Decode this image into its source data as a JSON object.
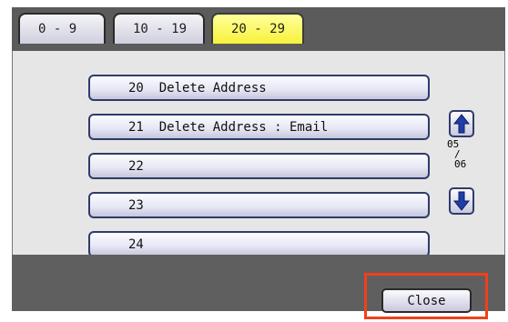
{
  "tabs": [
    {
      "label": "0 - 9",
      "active": false
    },
    {
      "label": "10 - 19",
      "active": false
    },
    {
      "label": "20 - 29",
      "active": true
    }
  ],
  "rows": [
    {
      "label": "20  Delete Address"
    },
    {
      "label": "21  Delete Address : Email"
    },
    {
      "label": "22"
    },
    {
      "label": "23"
    },
    {
      "label": "24"
    }
  ],
  "pager": {
    "current": "05",
    "separator": "/",
    "total": "06"
  },
  "footer": {
    "close_label": "Close"
  },
  "colors": {
    "active_tab": "#f6f23a",
    "highlight": "#f0411b",
    "button_border": "#2f3b6a"
  }
}
